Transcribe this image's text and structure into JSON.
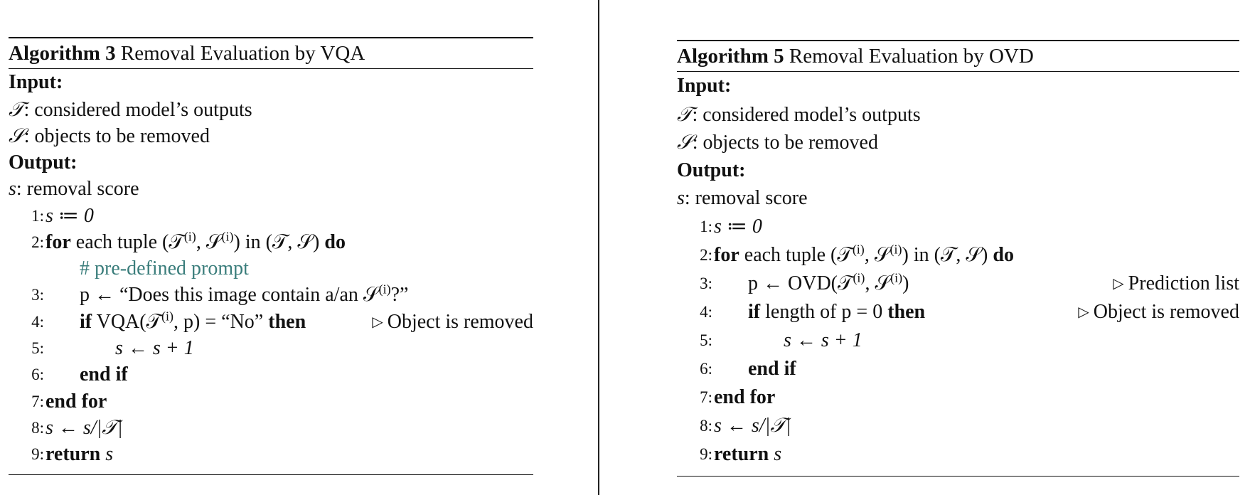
{
  "algorithm_3": {
    "label": "Algorithm 3",
    "title": "Removal Evaluation by VQA",
    "input_label": "Input:",
    "inputs": [
      {
        "symbol": "𝒯",
        "text": ": considered model’s outputs"
      },
      {
        "symbol": "𝒮",
        "text": ": objects to be removed"
      }
    ],
    "output_label": "Output:",
    "outputs": [
      {
        "symbol": "s",
        "text": ": removal score"
      }
    ],
    "lines": {
      "n1": "1:",
      "l1": "s ≔ 0",
      "n2": "2:",
      "l2_kw1": "for",
      "l2_mid": " each tuple (𝒯",
      "l2_sup1": "(i)",
      "l2_mid2": ", 𝒮",
      "l2_sup2": "(i)",
      "l2_mid3": ") in (𝒯, 𝒮) ",
      "l2_kw2": "do",
      "comment": "# pre-defined prompt",
      "n3": "3:",
      "l3a": "p ← “Does this image contain a/an 𝒮",
      "l3_sup": "(i)",
      "l3b": "?”",
      "n4": "4:",
      "l4_kw1": "if",
      "l4_mid": " VQA(𝒯",
      "l4_sup": "(i)",
      "l4_mid2": ", p) = “No” ",
      "l4_kw2": "then",
      "l4_comment": "Object is removed",
      "n5": "5:",
      "l5": "s ← s + 1",
      "n6": "6:",
      "l6": "end if",
      "n7": "7:",
      "l7": "end for",
      "n8": "8:",
      "l8": "s ← s/|𝒯|",
      "n9": "9:",
      "l9_kw": "return",
      "l9": " s"
    }
  },
  "algorithm_5": {
    "label": "Algorithm 5",
    "title": "Removal Evaluation by OVD",
    "input_label": "Input:",
    "inputs": [
      {
        "symbol": "𝒯",
        "text": ": considered model’s outputs"
      },
      {
        "symbol": "𝒮",
        "text": ": objects to be removed"
      }
    ],
    "output_label": "Output:",
    "outputs": [
      {
        "symbol": "s",
        "text": ": removal score"
      }
    ],
    "lines": {
      "n1": "1:",
      "l1": "s ≔ 0",
      "n2": "2:",
      "l2_kw1": "for",
      "l2_mid": " each tuple (𝒯",
      "l2_sup1": "(i)",
      "l2_mid2": ", 𝒮",
      "l2_sup2": "(i)",
      "l2_mid3": ") in (𝒯, 𝒮) ",
      "l2_kw2": "do",
      "n3": "3:",
      "l3a": "p ← OVD(𝒯",
      "l3_sup1": "(i)",
      "l3b": ", 𝒮",
      "l3_sup2": "(i)",
      "l3c": ")",
      "l3_comment": "Prediction list",
      "n4": "4:",
      "l4_kw1": "if",
      "l4_mid": " length of p = 0 ",
      "l4_kw2": "then",
      "l4_comment": "Object is removed",
      "n5": "5:",
      "l5": "s ← s + 1",
      "n6": "6:",
      "l6": "end if",
      "n7": "7:",
      "l7": "end for",
      "n8": "8:",
      "l8": "s ← s/|𝒯|",
      "n9": "9:",
      "l9_kw": "return",
      "l9": " s"
    }
  },
  "comment_triangle": "▷",
  "colors": {
    "comment_green": "#3a7d7b",
    "text": "#111111"
  }
}
